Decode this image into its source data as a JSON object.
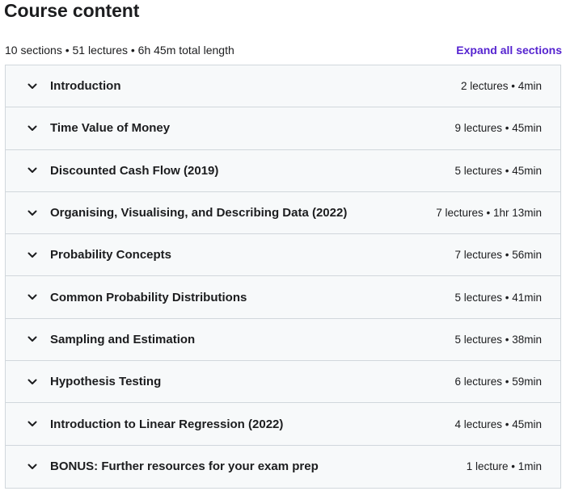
{
  "header": {
    "title": "Course content",
    "summary": "10 sections • 51 lectures • 6h 45m total length",
    "expand_label": "Expand all sections"
  },
  "colors": {
    "link": "#5624d0",
    "section_bg": "#f7f9fa",
    "border": "#d1d7dc",
    "text": "#1c1d1f"
  },
  "sections": [
    {
      "title": "Introduction",
      "meta": "2 lectures • 4min"
    },
    {
      "title": "Time Value of Money",
      "meta": "9 lectures • 45min"
    },
    {
      "title": "Discounted Cash Flow (2019)",
      "meta": "5 lectures • 45min"
    },
    {
      "title": "Organising, Visualising, and Describing Data (2022)",
      "meta": "7 lectures • 1hr 13min"
    },
    {
      "title": "Probability Concepts",
      "meta": "7 lectures • 56min"
    },
    {
      "title": "Common Probability Distributions",
      "meta": "5 lectures • 41min"
    },
    {
      "title": "Sampling and Estimation",
      "meta": "5 lectures • 38min"
    },
    {
      "title": "Hypothesis Testing",
      "meta": "6 lectures • 59min"
    },
    {
      "title": "Introduction to Linear Regression (2022)",
      "meta": "4 lectures • 45min"
    },
    {
      "title": "BONUS: Further resources for your exam prep",
      "meta": "1 lecture • 1min"
    }
  ]
}
